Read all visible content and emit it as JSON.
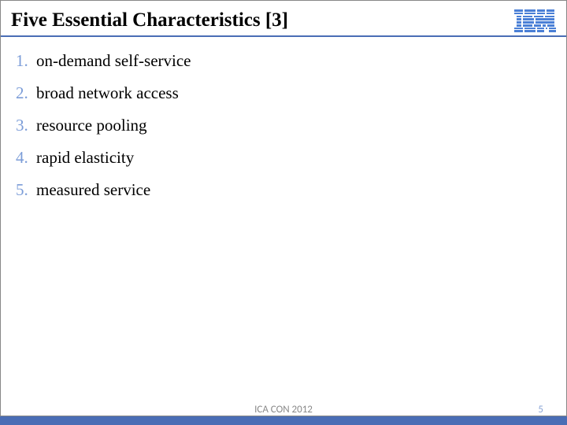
{
  "header": {
    "title": "Five Essential Characteristics [3]"
  },
  "list": {
    "items": [
      {
        "num": "1.",
        "text": "on-demand self-service"
      },
      {
        "num": "2.",
        "text": "broad network access"
      },
      {
        "num": "3.",
        "text": "resource pooling"
      },
      {
        "num": "4.",
        "text": "rapid elasticity"
      },
      {
        "num": "5.",
        "text": "measured service"
      }
    ]
  },
  "footer": {
    "text": "ICA CON 2012",
    "page": "5"
  }
}
